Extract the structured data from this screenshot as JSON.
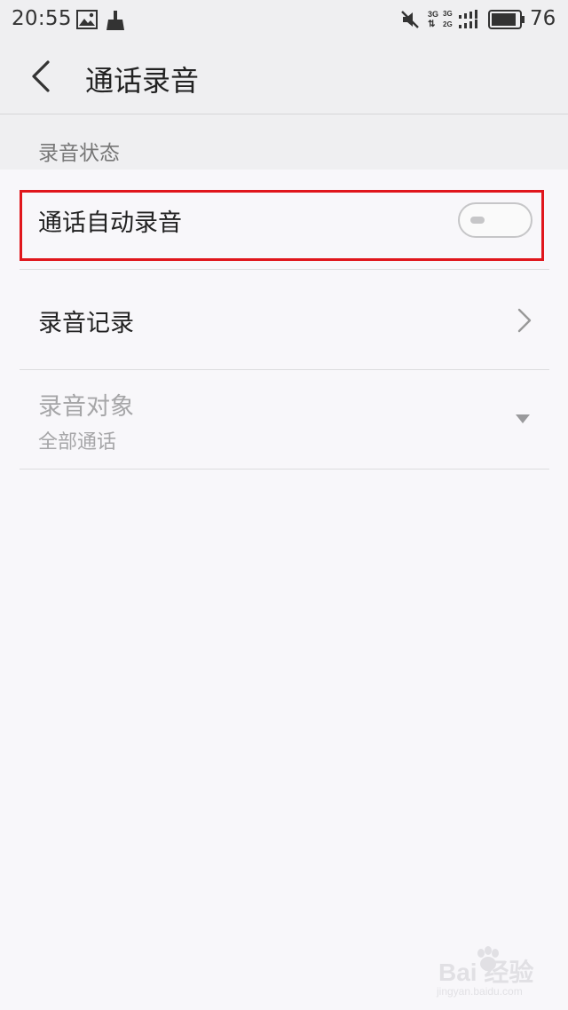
{
  "status_bar": {
    "time": "20:55",
    "battery_level": "76",
    "icons": [
      "image-icon",
      "broom-icon",
      "mute-icon",
      "network-3g-icon",
      "network-2g-icon",
      "signal-icon",
      "battery-icon"
    ],
    "network_labels": [
      "3G",
      "3G",
      "2G"
    ]
  },
  "header": {
    "title": "通话录音",
    "back_icon": "chevron-left-icon"
  },
  "section": {
    "title": "录音状态"
  },
  "settings": {
    "auto_record": {
      "label": "通话自动录音",
      "enabled": false,
      "highlight_color": "#e0161c"
    },
    "records": {
      "label": "录音记录",
      "icon": "chevron-right-icon"
    },
    "target": {
      "label": "录音对象",
      "value": "全部通话",
      "disabled": true,
      "icon": "dropdown-arrow-icon"
    }
  },
  "watermark": {
    "text": "Bai 经验",
    "url": "jingyan.baidu.com"
  }
}
